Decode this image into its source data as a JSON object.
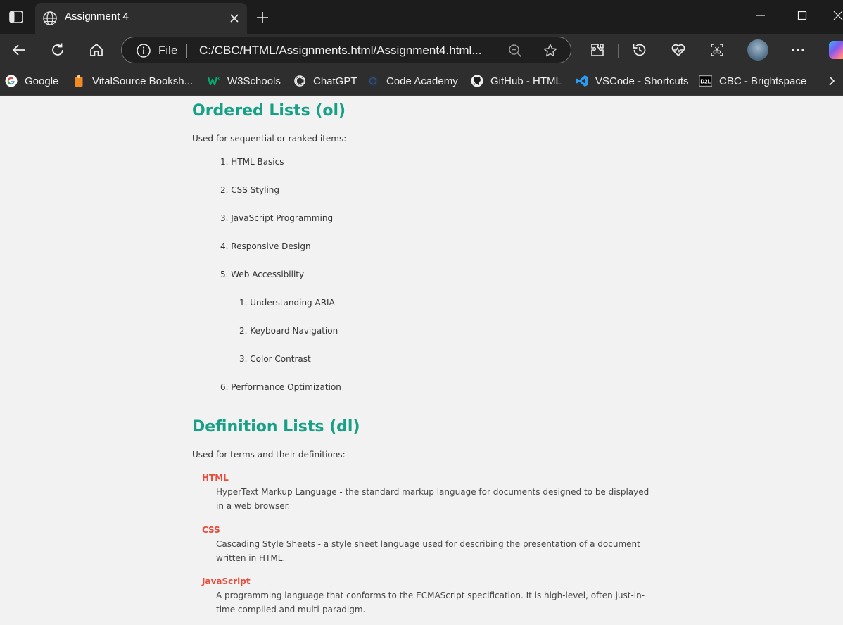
{
  "browser": {
    "tab": {
      "title": "Assignment 4"
    },
    "address": {
      "scheme_label": "File",
      "url": "C:/CBC/HTML/Assignments.html/Assignment4.html..."
    },
    "bookmarks": [
      {
        "label": "Google",
        "icon": "google-icon"
      },
      {
        "label": "VitalSource Booksh...",
        "icon": "vitalsource-icon"
      },
      {
        "label": "W3Schools",
        "icon": "w3schools-icon"
      },
      {
        "label": "ChatGPT",
        "icon": "chatgpt-icon"
      },
      {
        "label": "Code Academy",
        "icon": "codeacademy-icon"
      },
      {
        "label": "GitHub - HTML",
        "icon": "github-icon"
      },
      {
        "label": "VSCode - Shortcuts",
        "icon": "vscode-icon"
      },
      {
        "label": "CBC - Brightspace",
        "icon": "d2l-icon"
      }
    ]
  },
  "content": {
    "ordered": {
      "heading": "Ordered Lists (ol)",
      "intro": "Used for sequential or ranked items:",
      "items": [
        "1. HTML Basics",
        "2. CSS Styling",
        "3. JavaScript Programming",
        "4. Responsive Design",
        "5. Web Accessibility",
        "6. Performance Optimization"
      ],
      "subitems": [
        "1. Understanding ARIA",
        "2. Keyboard Navigation",
        "3. Color Contrast"
      ]
    },
    "definition": {
      "heading": "Definition Lists (dl)",
      "intro": "Used for terms and their definitions:",
      "entries": [
        {
          "term": "HTML",
          "definition": "HyperText Markup Language - the standard markup language for documents designed to be displayed in a web browser."
        },
        {
          "term": "CSS",
          "definition": "Cascading Style Sheets - a style sheet language used for describing the presentation of a document written in HTML."
        },
        {
          "term": "JavaScript",
          "definition": "A programming language that conforms to the ECMAScript specification. It is high-level, often just-in-time compiled and multi-paradigm."
        }
      ]
    }
  },
  "colors": {
    "heading": "#16a085",
    "term": "#e74c3c",
    "chrome_dark": "#1c1c1c",
    "toolbar": "#2e2e2e"
  }
}
